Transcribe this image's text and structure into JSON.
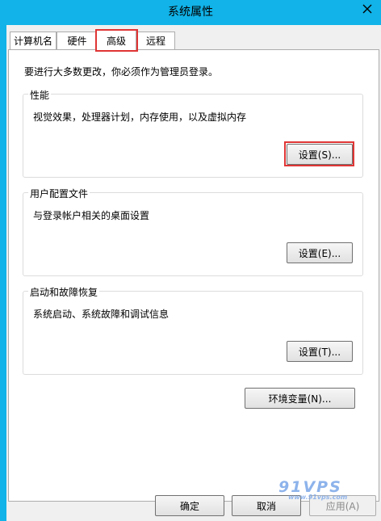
{
  "window": {
    "title": "系统属性"
  },
  "tabs": [
    {
      "label": "计算机名"
    },
    {
      "label": "硬件"
    },
    {
      "label": "高级"
    },
    {
      "label": "远程"
    }
  ],
  "notice": "要进行大多数更改，你必须作为管理员登录。",
  "groups": {
    "performance": {
      "title": "性能",
      "desc": "视觉效果，处理器计划，内存使用，以及虚拟内存",
      "button": "设置(S)..."
    },
    "profiles": {
      "title": "用户配置文件",
      "desc": "与登录帐户相关的桌面设置",
      "button": "设置(E)..."
    },
    "startup": {
      "title": "启动和故障恢复",
      "desc": "系统启动、系统故障和调试信息",
      "button": "设置(T)..."
    }
  },
  "env_button": "环境变量(N)...",
  "footer": {
    "ok": "确定",
    "cancel": "取消",
    "apply": "应用(A)"
  },
  "watermark": {
    "brand": "91VPS",
    "url": "www.91vps.com"
  },
  "colors": {
    "titlebar": "#11b3e8",
    "highlight": "#e03535"
  }
}
